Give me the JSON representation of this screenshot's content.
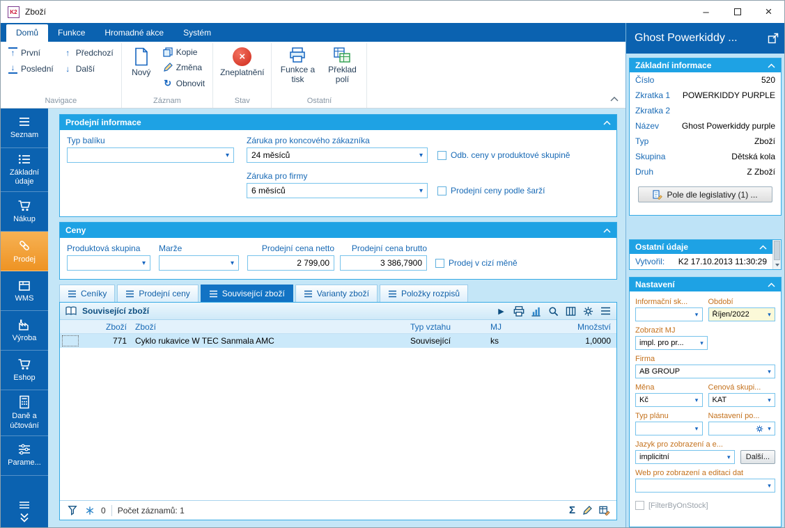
{
  "window": {
    "logo": "K2",
    "title": "Zboží",
    "controls": {
      "minimize": "–",
      "close": "×"
    }
  },
  "icons": {
    "combo_arrow": "▾",
    "up_arrow": "↑",
    "down_arrow": "↓",
    "refresh": "↻",
    "play": "▶",
    "sum": "Σ"
  },
  "colors": {
    "accent_blue": "#0b62b0",
    "section_header_blue": "#1ea2e4",
    "background_light_blue": "#c4e6f7",
    "label_blue": "#1769b5",
    "label_orange": "#c4711c",
    "active_sidebar_orange": "#ee9323",
    "selected_row_blue": "#cbe9fa",
    "invalid_red": "#cf2a1b"
  },
  "ribbon": {
    "tabs": [
      {
        "label": "Domů",
        "active": true
      },
      {
        "label": "Funkce",
        "active": false
      },
      {
        "label": "Hromadné akce",
        "active": false
      },
      {
        "label": "Systém",
        "active": false
      }
    ],
    "groups": [
      {
        "label": "Navigace",
        "items": [
          {
            "label": "První"
          },
          {
            "label": "Poslední"
          },
          {
            "label": "Předchozí"
          },
          {
            "label": "Další"
          }
        ]
      },
      {
        "label": "Záznam",
        "items": [
          {
            "label": "Nový"
          },
          {
            "label": "Kopie"
          },
          {
            "label": "Změna"
          },
          {
            "label": "Obnovit"
          }
        ]
      },
      {
        "label": "Stav",
        "items": [
          {
            "label": "Zneplatnění"
          }
        ]
      },
      {
        "label": "Ostatní",
        "items": [
          {
            "label": "Funkce a tisk"
          },
          {
            "label": "Překlad polí"
          }
        ]
      }
    ]
  },
  "sidebar": {
    "items": [
      {
        "label": "Seznam",
        "icon": "menu-icon",
        "active": false
      },
      {
        "label": "Základní údaje",
        "icon": "list-icon",
        "active": false
      },
      {
        "label": "Nákup",
        "icon": "cart-icon",
        "active": false
      },
      {
        "label": "Prodej",
        "icon": "link-icon",
        "active": true
      },
      {
        "label": "WMS",
        "icon": "box-icon",
        "active": false
      },
      {
        "label": "Výroba",
        "icon": "factory-icon",
        "active": false
      },
      {
        "label": "Eshop",
        "icon": "cart-icon",
        "active": false
      },
      {
        "label": "Daně a účtování",
        "icon": "calculator-icon",
        "active": false
      },
      {
        "label": "Parame...",
        "icon": "sliders-icon",
        "active": false
      }
    ]
  },
  "sales_info": {
    "title": "Prodejní informace",
    "package_type": {
      "label": "Typ balíku",
      "value": ""
    },
    "warranty_customer": {
      "label": "Záruka pro koncového zákazníka",
      "value": "24 měsíců"
    },
    "warranty_companies": {
      "label": "Záruka pro firmy",
      "value": "6 měsíců"
    },
    "checkbox_group_prices": {
      "label": "Odb. ceny v produktové skupině",
      "checked": false
    },
    "checkbox_batch_prices": {
      "label": "Prodejní ceny podle šarží",
      "checked": false
    }
  },
  "prices": {
    "title": "Ceny",
    "product_group": {
      "label": "Produktová skupina",
      "value": ""
    },
    "margin": {
      "label": "Marže",
      "value": ""
    },
    "price_net": {
      "label": "Prodejní cena netto",
      "value": "2 799,00"
    },
    "price_gross": {
      "label": "Prodejní cena brutto",
      "value": "3 386,7900"
    },
    "checkbox_foreign": {
      "label": "Prodej v cizí měně",
      "checked": false
    }
  },
  "detail_tabs": [
    {
      "label": "Ceníky",
      "active": false
    },
    {
      "label": "Prodejní ceny",
      "active": false
    },
    {
      "label": "Související zboží",
      "active": true
    },
    {
      "label": "Varianty zboží",
      "active": false
    },
    {
      "label": "Položky rozpisů",
      "active": false
    }
  ],
  "related_goods": {
    "title": "Související zboží",
    "columns": [
      "Zboží",
      "Zboží",
      "Typ vztahu",
      "MJ",
      "Množství"
    ],
    "rows": [
      {
        "id": "771",
        "name": "Cyklo rukavice W TEC Sanmala AMC",
        "relation": "Související",
        "unit": "ks",
        "quantity": "1,0000"
      }
    ],
    "status": {
      "filter_count": "0",
      "records": "Počet záznamů: 1"
    }
  },
  "right_panel": {
    "title": "Ghost Powerkiddy ...",
    "basic_info": {
      "title": "Základní informace",
      "fields": [
        {
          "label": "Číslo",
          "value": "520"
        },
        {
          "label": "Zkratka 1",
          "value": "POWERKIDDY PURPLE"
        },
        {
          "label": "Zkratka 2",
          "value": ""
        },
        {
          "label": "Název",
          "value": "Ghost Powerkiddy purple"
        },
        {
          "label": "Typ",
          "value": "Zboží"
        },
        {
          "label": "Skupina",
          "value": "Dětská kola"
        },
        {
          "label": "Druh",
          "value": "Z Zboží"
        }
      ],
      "legislative_button": "Pole dle legislativy (1) ..."
    },
    "other_info": {
      "title": "Ostatní údaje",
      "created": {
        "label": "Vytvořil:",
        "value": "K2 17.10.2013 11:30:29"
      }
    },
    "settings": {
      "title": "Nastavení",
      "info_group": {
        "label": "Informační sk...",
        "value": ""
      },
      "period": {
        "label": "Období",
        "value": "Říjen/2022"
      },
      "show_unit": {
        "label": "Zobrazit MJ",
        "value": "impl. pro pr..."
      },
      "company": {
        "label": "Firma",
        "value": "AB GROUP"
      },
      "currency": {
        "label": "Měna",
        "value": "Kč"
      },
      "price_group": {
        "label": "Cenová skupi...",
        "value": "KAT"
      },
      "plan_type": {
        "label": "Typ plánu",
        "value": ""
      },
      "order_settings": {
        "label": "Nastavení po...",
        "value": ""
      },
      "language": {
        "label": "Jazyk pro zobrazení a e...",
        "value": "implicitní"
      },
      "more_button": "Další...",
      "web": {
        "label": "Web pro zobrazení a editaci dat",
        "value": ""
      },
      "filter_checkbox": {
        "label": "[FilterByOnStock]",
        "checked": false
      }
    }
  }
}
